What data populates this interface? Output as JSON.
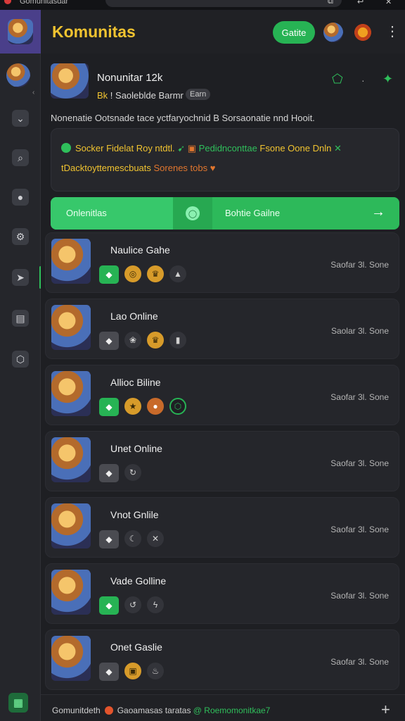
{
  "browser": {
    "tab_title": "Gomunitasdar"
  },
  "app": {
    "title": "Komunitas",
    "header_button": "Gatite",
    "more_glyph": "⋮"
  },
  "summary": {
    "name": "Nonunitar 12k",
    "meta_level": "Bk",
    "meta_text": "! Saoleblde Barmr",
    "chip": "Earn",
    "desc": "Nonenatie Ootsnade tace yctfaryochnid B Sorsaonatie nnd Hooit."
  },
  "panel": {
    "row1": {
      "a": "Socker Fidelat Roy ntdtl.",
      "b": "Pedidnconttae",
      "c": "Fsone Oone Dnln"
    },
    "row2": {
      "a": "tDacktoyttemescbuats",
      "b": "Sorenes tobs"
    }
  },
  "bar": {
    "left_label": "Onlenitlas",
    "right_label": "Bohtie Gailne",
    "arrow": "→"
  },
  "members": [
    {
      "name": "Naulice Gahe",
      "status": "Saofar 3l. Sone"
    },
    {
      "name": "Lao Online",
      "status": "Saolar 3l. Sone"
    },
    {
      "name": "Allioc Biline",
      "status": "Saofar 3l. Sone"
    },
    {
      "name": "Unet Online",
      "status": "Saofar 3l. Sone"
    },
    {
      "name": "Vnot Gnlile",
      "status": "Saofar 3l. Sone"
    },
    {
      "name": "Vade Golline",
      "status": "Saofar 3l. Sone"
    },
    {
      "name": "Onet Gaslie",
      "status": "Saofar 3l. Sone"
    }
  ],
  "footer": {
    "a": "Gomunitdeth",
    "b": "Gaoamasas taratas",
    "c": "@ Roemomonitkae7",
    "plus": "+"
  },
  "icons": [
    "chevron-icon",
    "grid-icon",
    "search-icon",
    "user-icon",
    "gear-icon",
    "send-icon",
    "chart-icon",
    "shield-icon",
    "bookmark-icon",
    "map-icon"
  ]
}
